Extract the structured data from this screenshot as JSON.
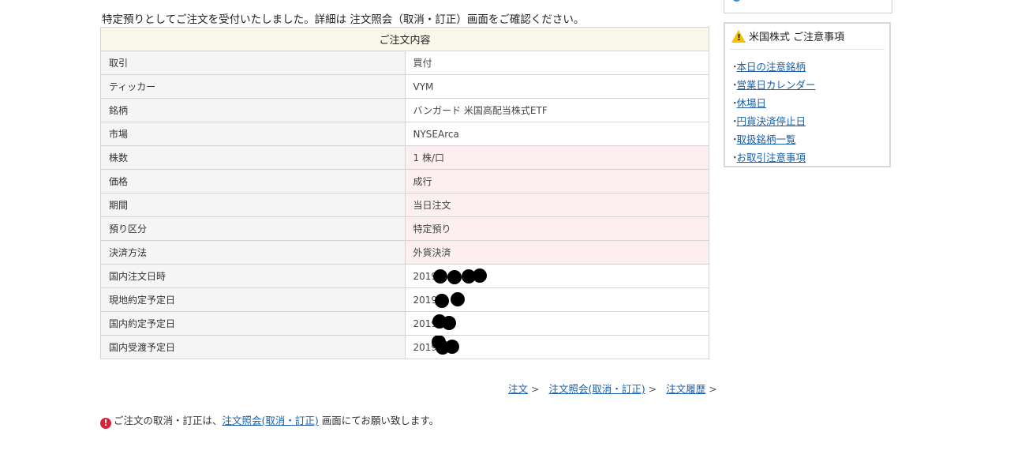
{
  "message": "特定預りとしてご注文を受付いたしました。詳細は 注文照会（取消・訂正）画面をご確認ください。",
  "order": {
    "header": "ご注文内容",
    "rows": [
      {
        "label": "取引",
        "value": "買付",
        "highlight": false
      },
      {
        "label": "ティッカー",
        "value": "VYM",
        "highlight": false
      },
      {
        "label": "銘柄",
        "value": "バンガード 米国高配当株式ETF",
        "highlight": false
      },
      {
        "label": "市場",
        "value": "NYSEArca",
        "highlight": false
      },
      {
        "label": "株数",
        "value": "1 株/口",
        "highlight": true
      },
      {
        "label": "価格",
        "value": "成行",
        "highlight": true
      },
      {
        "label": "期間",
        "value": "当日注文",
        "highlight": true
      },
      {
        "label": "預り区分",
        "value": "特定預り",
        "highlight": true
      },
      {
        "label": "決済方法",
        "value": "外貨決済",
        "highlight": true
      },
      {
        "label": "国内注文日時",
        "value": "2019/",
        "highlight": false
      },
      {
        "label": "現地約定予定日",
        "value": "2019/",
        "highlight": false
      },
      {
        "label": "国内約定予定日",
        "value": "2019/",
        "highlight": false
      },
      {
        "label": "国内受渡予定日",
        "value": "2019/",
        "highlight": false
      }
    ]
  },
  "links": {
    "order": "注文",
    "inquiry": "注文照会(取消・訂正)",
    "history": "注文履歴"
  },
  "notice": {
    "before": "ご注文の取消・訂正は、",
    "link": "注文照会(取消・訂正)",
    "after": "画面にてお願い致します。"
  },
  "sidebar": {
    "title": "米国株式 ご注意事項",
    "items": [
      "本日の注意銘柄",
      "営業日カレンダー",
      "休場日",
      "円貨決済停止日",
      "取扱銘柄一覧",
      "お取引注意事項"
    ]
  },
  "colors": {
    "link": "#1a5fa8",
    "header_bg": "#f9f7ea",
    "highlight_bg": "#fdeef0",
    "notice_icon": "#d8243a",
    "warning_icon": "#f2c200"
  }
}
